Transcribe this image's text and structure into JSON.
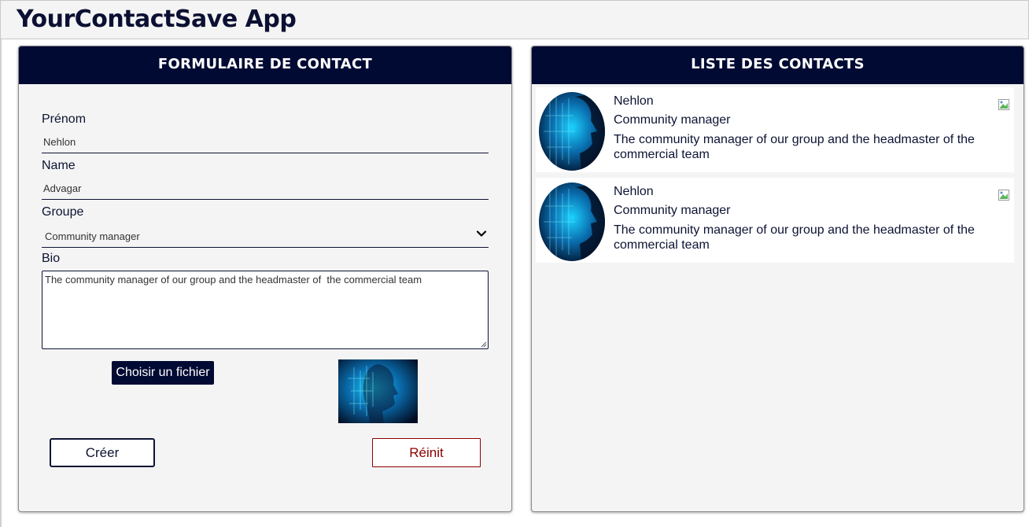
{
  "app": {
    "title": "YourContactSave App"
  },
  "form": {
    "header": "FORMULAIRE DE CONTACT",
    "first_name": {
      "label": "Prénom",
      "value": "Nehlon"
    },
    "last_name": {
      "label": "Name",
      "value": "Advagar"
    },
    "group": {
      "label": "Groupe",
      "value": "Community manager"
    },
    "bio": {
      "label": "Bio",
      "value": "The community manager of our group and the headmaster of  the commercial team"
    },
    "file_button": "Choisir un fichier",
    "create_button": "Créer",
    "reset_button": "Réinit"
  },
  "list": {
    "header": "LISTE DES CONTACTS",
    "contacts": [
      {
        "name": "Nehlon",
        "group": "Community manager",
        "bio": "The community manager of our group and the headmaster of the commercial team"
      },
      {
        "name": "Nehlon",
        "group": "Community manager",
        "bio": "The community manager of our group and the headmaster of the commercial team"
      }
    ]
  },
  "colors": {
    "navy": "#000a33",
    "panel_bg": "#f4f4f4",
    "reset_red": "#8b0000",
    "header_bg": "#f4f4f4"
  },
  "icons": [
    "chevron-down-icon",
    "broken-image-icon",
    "resize-grip-icon"
  ]
}
